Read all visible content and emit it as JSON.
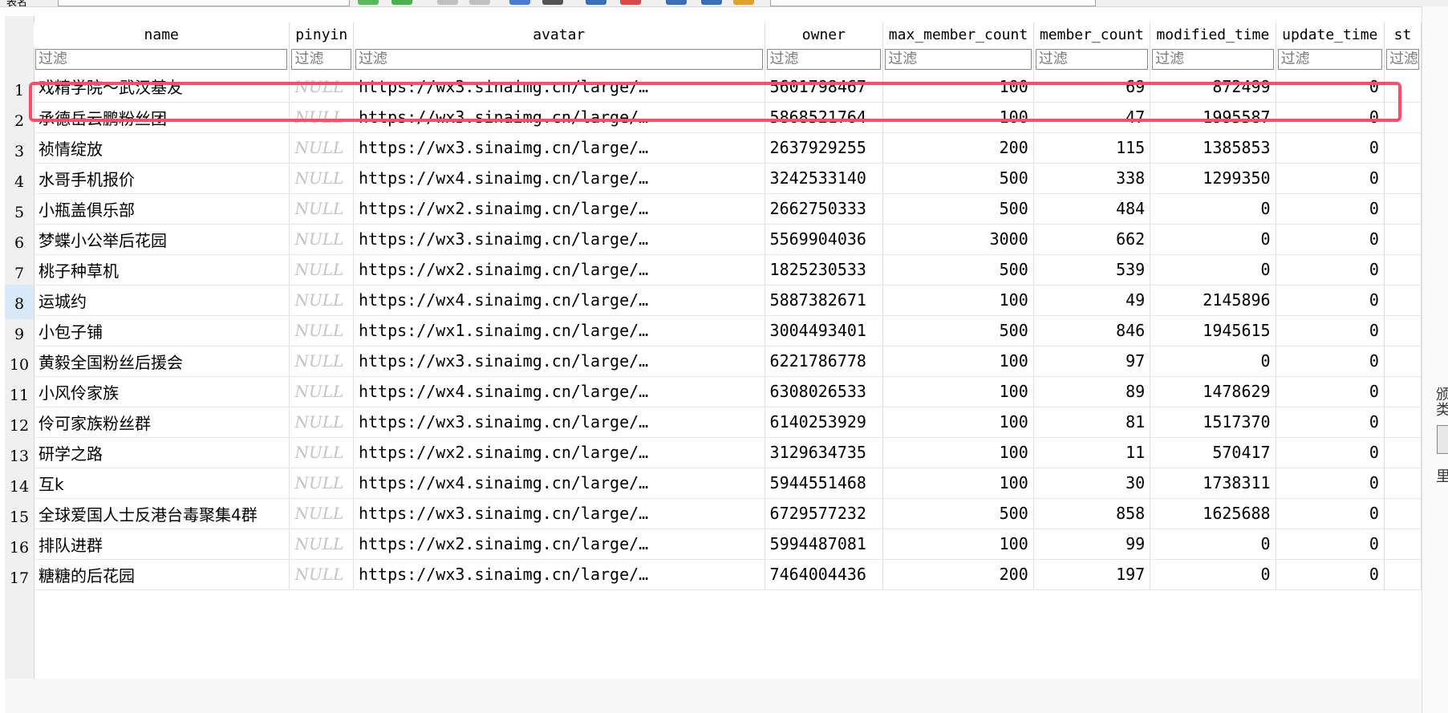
{
  "toolbar": {
    "label": "表名"
  },
  "columns": [
    {
      "key": "name",
      "label": "name",
      "width": 322,
      "align": "left"
    },
    {
      "key": "pinyin",
      "label": "pinyin",
      "width": 80,
      "align": "left"
    },
    {
      "key": "avatar",
      "label": "avatar",
      "width": 525,
      "align": "left"
    },
    {
      "key": "owner",
      "label": "owner",
      "width": 149,
      "align": "left"
    },
    {
      "key": "max_member_count",
      "label": "max_member_count",
      "width": 188,
      "align": "right"
    },
    {
      "key": "member_count",
      "label": "member_count",
      "width": 146,
      "align": "right"
    },
    {
      "key": "modified_time",
      "label": "modified_time",
      "width": 157,
      "align": "right"
    },
    {
      "key": "update_time",
      "label": "update_time",
      "width": 136,
      "align": "right"
    },
    {
      "key": "st",
      "label": "st",
      "width": 30,
      "align": "left"
    }
  ],
  "filter_placeholder": "过滤",
  "rows": [
    {
      "n": "1",
      "name": "戏精学院～武汉基友",
      "pinyin": "NULL",
      "avatar": "https://wx3.sinaimg.cn/large/…",
      "owner": "5601798467",
      "max_member_count": "100",
      "member_count": "69",
      "modified_time": "872499",
      "update_time": "0"
    },
    {
      "n": "2",
      "name": "承德岳云鹏粉丝团",
      "pinyin": "NULL",
      "avatar": "https://wx3.sinaimg.cn/large/…",
      "owner": "5868521764",
      "max_member_count": "100",
      "member_count": "47",
      "modified_time": "1995587",
      "update_time": "0"
    },
    {
      "n": "3",
      "name": "祯情绽放",
      "pinyin": "NULL",
      "avatar": "https://wx3.sinaimg.cn/large/…",
      "owner": "2637929255",
      "max_member_count": "200",
      "member_count": "115",
      "modified_time": "1385853",
      "update_time": "0"
    },
    {
      "n": "4",
      "name": "水哥手机报价",
      "pinyin": "NULL",
      "avatar": "https://wx4.sinaimg.cn/large/…",
      "owner": "3242533140",
      "max_member_count": "500",
      "member_count": "338",
      "modified_time": "1299350",
      "update_time": "0"
    },
    {
      "n": "5",
      "name": "小瓶盖俱乐部",
      "pinyin": "NULL",
      "avatar": "https://wx2.sinaimg.cn/large/…",
      "owner": "2662750333",
      "max_member_count": "500",
      "member_count": "484",
      "modified_time": "0",
      "update_time": "0"
    },
    {
      "n": "6",
      "name": "梦蝶小公举后花园",
      "pinyin": "NULL",
      "avatar": "https://wx3.sinaimg.cn/large/…",
      "owner": "5569904036",
      "max_member_count": "3000",
      "member_count": "662",
      "modified_time": "0",
      "update_time": "0"
    },
    {
      "n": "7",
      "name": "桃子种草机",
      "pinyin": "NULL",
      "avatar": "https://wx2.sinaimg.cn/large/…",
      "owner": "1825230533",
      "max_member_count": "500",
      "member_count": "539",
      "modified_time": "0",
      "update_time": "0"
    },
    {
      "n": "8",
      "name": "运城约",
      "pinyin": "NULL",
      "avatar": "https://wx4.sinaimg.cn/large/…",
      "owner": "5887382671",
      "max_member_count": "100",
      "member_count": "49",
      "modified_time": "2145896",
      "update_time": "0"
    },
    {
      "n": "9",
      "name": "小包子铺",
      "pinyin": "NULL",
      "avatar": "https://wx1.sinaimg.cn/large/…",
      "owner": "3004493401",
      "max_member_count": "500",
      "member_count": "846",
      "modified_time": "1945615",
      "update_time": "0"
    },
    {
      "n": "10",
      "name": "黄毅全国粉丝后援会",
      "pinyin": "NULL",
      "avatar": "https://wx3.sinaimg.cn/large/…",
      "owner": "6221786778",
      "max_member_count": "100",
      "member_count": "97",
      "modified_time": "0",
      "update_time": "0"
    },
    {
      "n": "11",
      "name": "小风伶家族",
      "pinyin": "NULL",
      "avatar": "https://wx4.sinaimg.cn/large/…",
      "owner": "6308026533",
      "max_member_count": "100",
      "member_count": "89",
      "modified_time": "1478629",
      "update_time": "0"
    },
    {
      "n": "12",
      "name": "伶可家族粉丝群",
      "pinyin": "NULL",
      "avatar": "https://wx3.sinaimg.cn/large/…",
      "owner": "6140253929",
      "max_member_count": "100",
      "member_count": "81",
      "modified_time": "1517370",
      "update_time": "0"
    },
    {
      "n": "13",
      "name": "研学之路",
      "pinyin": "NULL",
      "avatar": "https://wx2.sinaimg.cn/large/…",
      "owner": "3129634735",
      "max_member_count": "100",
      "member_count": "11",
      "modified_time": "570417",
      "update_time": "0"
    },
    {
      "n": "14",
      "name": "互k",
      "pinyin": "NULL",
      "avatar": "https://wx4.sinaimg.cn/large/…",
      "owner": "5944551468",
      "max_member_count": "100",
      "member_count": "30",
      "modified_time": "1738311",
      "update_time": "0"
    },
    {
      "n": "15",
      "name": "全球爱国人士反港台毒聚集4群",
      "pinyin": "NULL",
      "avatar": "https://wx3.sinaimg.cn/large/…",
      "owner": "6729577232",
      "max_member_count": "500",
      "member_count": "858",
      "modified_time": "1625688",
      "update_time": "0"
    },
    {
      "n": "16",
      "name": " 排队进群",
      "pinyin": "NULL",
      "avatar": "https://wx2.sinaimg.cn/large/…",
      "owner": "5994487081",
      "max_member_count": "100",
      "member_count": "99",
      "modified_time": "0",
      "update_time": "0"
    },
    {
      "n": "17",
      "name": "糖糖的后花园",
      "pinyin": "NULL",
      "avatar": "https://wx3.sinaimg.cn/large/…",
      "owner": "7464004436",
      "max_member_count": "200",
      "member_count": "197",
      "modified_time": "0",
      "update_time": "0"
    }
  ],
  "selected_row": "8",
  "highlighted_row": "1",
  "colors": {
    "highlight_border": "#ff4d6a",
    "selected_rownum_bg": "#d8e9f8",
    "null_text": "#c3c3c3"
  },
  "side_fragments": [
    "颁",
    "类",
    "里"
  ]
}
